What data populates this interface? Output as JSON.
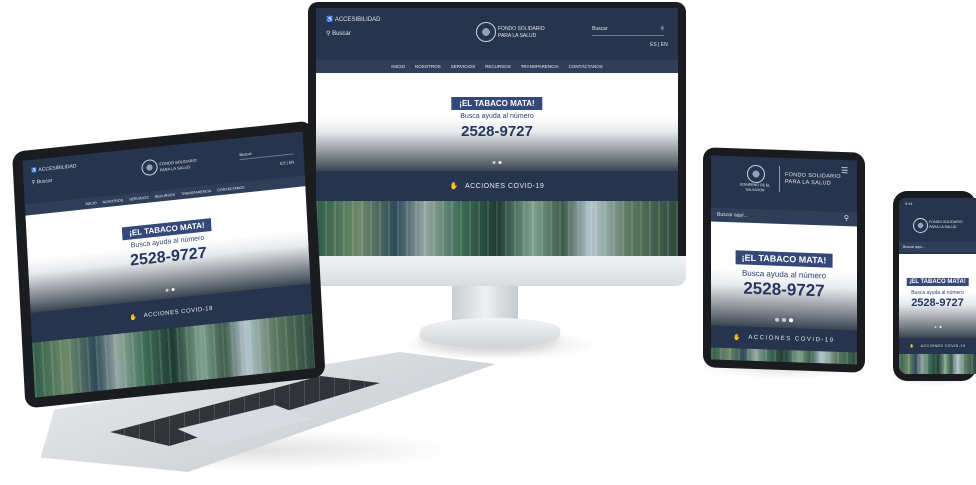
{
  "brand": {
    "name_line1": "FONDO SOLIDARIO",
    "name_line2": "PARA LA SALUD",
    "gov_label": "GOBIERNO DE EL SALVADOR"
  },
  "header": {
    "accessibility_label": "ACCESIBILIDAD",
    "search_label": "Buscar",
    "search_placeholder": "Buscar aquí...",
    "lang": "ES | EN"
  },
  "nav": [
    "INICIO",
    "NOSOTROS",
    "SERVICIOS",
    "RECURSOS",
    "TRANSPARENCIA",
    "CONTÁCTANOS"
  ],
  "hero": {
    "badge": "¡EL TABACO MATA!",
    "help_text": "Busca ayuda al número",
    "phone": "2528-9727"
  },
  "band": {
    "label": "ACCIONES COVID-19",
    "icon": "hands-icon"
  },
  "colors": {
    "navy": "#26354d",
    "badge": "#35487a",
    "phone_text": "#24375e"
  }
}
